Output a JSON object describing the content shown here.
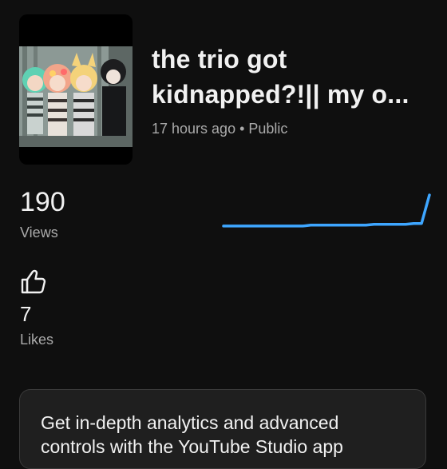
{
  "video": {
    "title": "the trio got kidnapped?!|| my o...",
    "age": "17 hours ago",
    "separator": "•",
    "visibility": "Public",
    "thumbnail_icon": "gacha-characters-thumbnail"
  },
  "stats": {
    "views_value": "190",
    "views_label": "Views",
    "likes_icon": "thumbs-up-icon",
    "likes_value": "7",
    "likes_label": "Likes"
  },
  "sparkline": {
    "color": "#3ea6ff",
    "values": [
      3,
      3,
      3,
      3,
      3,
      3,
      3,
      3,
      3,
      3,
      3,
      4,
      4,
      4,
      4,
      4,
      4,
      4,
      4,
      5,
      5,
      5,
      5,
      5,
      6,
      6,
      40
    ]
  },
  "promo": {
    "text": "Get in-depth analytics and advanced controls with the YouTube Studio app"
  }
}
